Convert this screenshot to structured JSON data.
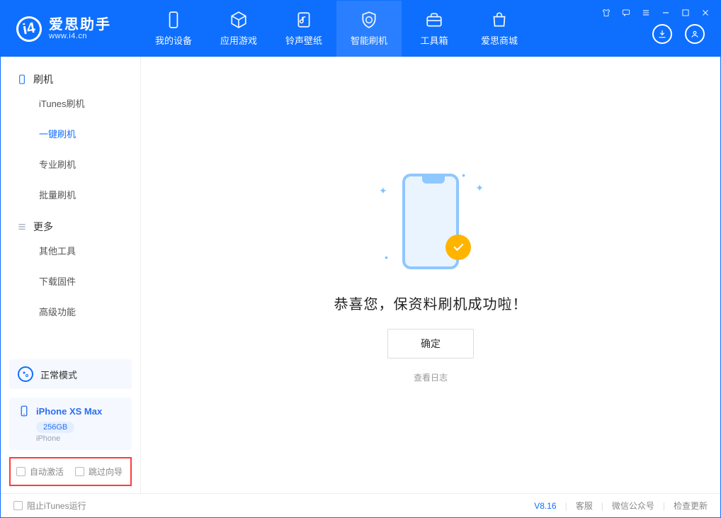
{
  "app": {
    "name": "爱思助手",
    "url": "www.i4.cn"
  },
  "nav": {
    "items": [
      {
        "label": "我的设备"
      },
      {
        "label": "应用游戏"
      },
      {
        "label": "铃声壁纸"
      },
      {
        "label": "智能刷机"
      },
      {
        "label": "工具箱"
      },
      {
        "label": "爱思商城"
      }
    ],
    "active_index": 3
  },
  "sidebar": {
    "groups": [
      {
        "title": "刷机",
        "items": [
          "iTunes刷机",
          "一键刷机",
          "专业刷机",
          "批量刷机"
        ],
        "active_index": 1
      },
      {
        "title": "更多",
        "items": [
          "其他工具",
          "下载固件",
          "高级功能"
        ],
        "active_index": -1
      }
    ],
    "mode": {
      "label": "正常模式"
    },
    "device": {
      "name": "iPhone XS Max",
      "capacity": "256GB",
      "type": "iPhone"
    },
    "options": [
      {
        "label": "自动激活",
        "checked": false
      },
      {
        "label": "跳过向导",
        "checked": false
      }
    ]
  },
  "main": {
    "message": "恭喜您，保资料刷机成功啦！",
    "confirm": "确定",
    "log_link": "查看日志"
  },
  "footer": {
    "block_itunes": "阻止iTunes运行",
    "version": "V8.16",
    "links": [
      "客服",
      "微信公众号",
      "检查更新"
    ]
  }
}
